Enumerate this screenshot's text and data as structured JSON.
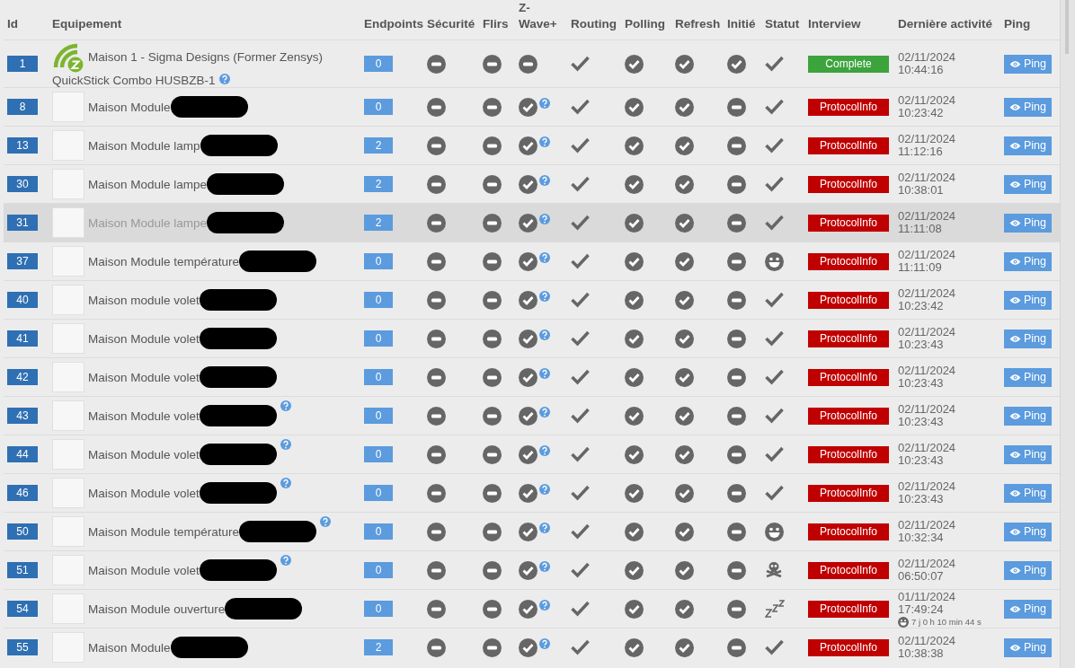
{
  "columns": [
    "Id",
    "Equipement",
    "Endpoints",
    "Sécurité",
    "Flirs",
    "Z-Wave+",
    "Routing",
    "Polling",
    "Refresh",
    "Initié",
    "Statut",
    "Interview",
    "Dernière activité",
    "Ping"
  ],
  "rows": [
    {
      "id": "1",
      "image": {
        "kind": "logo"
      },
      "name": "Maison 1 - Sigma Designs (Former Zensys)",
      "name_continued": "QuickStick Combo HUSBZB-1",
      "redacted": false,
      "name_help": true,
      "highlighted": false,
      "endpoints": "0",
      "indicators": [
        {
          "kind": "minus",
          "help": false
        },
        {
          "kind": "minus",
          "help": false
        },
        {
          "kind": "minus",
          "help": false
        },
        {
          "kind": "check",
          "help": false
        },
        {
          "kind": "check-circle",
          "help": false
        },
        {
          "kind": "check-circle",
          "help": false
        },
        {
          "kind": "check-circle",
          "help": false
        },
        {
          "kind": "check",
          "help": false
        }
      ],
      "interview": {
        "label": "Complete",
        "kind": "complete"
      },
      "date": "02/11/2024",
      "time": "10:44:16",
      "ping": "Ping"
    },
    {
      "id": "8",
      "image": {
        "kind": "photo"
      },
      "name": "Maison Module",
      "redacted": true,
      "name_help": false,
      "highlighted": false,
      "endpoints": "0",
      "indicators": [
        {
          "kind": "minus",
          "help": false
        },
        {
          "kind": "minus",
          "help": false
        },
        {
          "kind": "check-circle",
          "help": true
        },
        {
          "kind": "check",
          "help": false
        },
        {
          "kind": "check-circle",
          "help": false
        },
        {
          "kind": "check-circle",
          "help": false
        },
        {
          "kind": "minus",
          "help": false
        },
        {
          "kind": "check",
          "help": false
        }
      ],
      "interview": {
        "label": "ProtocolInfo",
        "kind": "error"
      },
      "date": "02/11/2024",
      "time": "10:23:42",
      "ping": "Ping"
    },
    {
      "id": "13",
      "image": {
        "kind": "photo"
      },
      "name": "Maison Module lamp",
      "redacted": true,
      "name_help": false,
      "highlighted": false,
      "endpoints": "2",
      "indicators": [
        {
          "kind": "minus",
          "help": false
        },
        {
          "kind": "minus",
          "help": false
        },
        {
          "kind": "check-circle",
          "help": true
        },
        {
          "kind": "check",
          "help": false
        },
        {
          "kind": "check-circle",
          "help": false
        },
        {
          "kind": "check-circle",
          "help": false
        },
        {
          "kind": "minus",
          "help": false
        },
        {
          "kind": "check",
          "help": false
        }
      ],
      "interview": {
        "label": "ProtocolInfo",
        "kind": "error"
      },
      "date": "02/11/2024",
      "time": "11:12:16",
      "ping": "Ping"
    },
    {
      "id": "30",
      "image": {
        "kind": "photo"
      },
      "name": "Maison Module lampe",
      "redacted": true,
      "name_help": false,
      "highlighted": false,
      "endpoints": "2",
      "indicators": [
        {
          "kind": "minus",
          "help": false
        },
        {
          "kind": "minus",
          "help": false
        },
        {
          "kind": "check-circle",
          "help": true
        },
        {
          "kind": "check",
          "help": false
        },
        {
          "kind": "check-circle",
          "help": false
        },
        {
          "kind": "check-circle",
          "help": false
        },
        {
          "kind": "minus",
          "help": false
        },
        {
          "kind": "check",
          "help": false
        }
      ],
      "interview": {
        "label": "ProtocolInfo",
        "kind": "error"
      },
      "date": "02/11/2024",
      "time": "10:38:01",
      "ping": "Ping"
    },
    {
      "id": "31",
      "image": {
        "kind": "photo"
      },
      "name": "Maison Module lampe",
      "redacted": true,
      "name_help": false,
      "highlighted": true,
      "endpoints": "2",
      "indicators": [
        {
          "kind": "minus",
          "help": false
        },
        {
          "kind": "minus",
          "help": false
        },
        {
          "kind": "check-circle",
          "help": true
        },
        {
          "kind": "check",
          "help": false
        },
        {
          "kind": "check-circle",
          "help": false
        },
        {
          "kind": "check-circle",
          "help": false
        },
        {
          "kind": "minus",
          "help": false
        },
        {
          "kind": "check",
          "help": false
        }
      ],
      "interview": {
        "label": "ProtocolInfo",
        "kind": "error"
      },
      "date": "02/11/2024",
      "time": "11:11:08",
      "ping": "Ping"
    },
    {
      "id": "37",
      "image": {
        "kind": "photo"
      },
      "name": "Maison Module température",
      "redacted": true,
      "name_help": false,
      "highlighted": false,
      "endpoints": "0",
      "indicators": [
        {
          "kind": "minus",
          "help": false
        },
        {
          "kind": "minus",
          "help": false
        },
        {
          "kind": "check-circle",
          "help": true
        },
        {
          "kind": "check",
          "help": false
        },
        {
          "kind": "check-circle",
          "help": false
        },
        {
          "kind": "check-circle",
          "help": false
        },
        {
          "kind": "minus",
          "help": false
        },
        {
          "kind": "smiley",
          "help": false
        }
      ],
      "interview": {
        "label": "ProtocolInfo",
        "kind": "error"
      },
      "date": "02/11/2024",
      "time": "11:11:09",
      "ping": "Ping"
    },
    {
      "id": "40",
      "image": {
        "kind": "photo"
      },
      "name": "Maison module volet",
      "redacted": true,
      "name_help": false,
      "highlighted": false,
      "endpoints": "0",
      "indicators": [
        {
          "kind": "minus",
          "help": false
        },
        {
          "kind": "minus",
          "help": false
        },
        {
          "kind": "check-circle",
          "help": true
        },
        {
          "kind": "check",
          "help": false
        },
        {
          "kind": "check-circle",
          "help": false
        },
        {
          "kind": "check-circle",
          "help": false
        },
        {
          "kind": "minus",
          "help": false
        },
        {
          "kind": "check",
          "help": false
        }
      ],
      "interview": {
        "label": "ProtocolInfo",
        "kind": "error"
      },
      "date": "02/11/2024",
      "time": "10:23:42",
      "ping": "Ping"
    },
    {
      "id": "41",
      "image": {
        "kind": "photo"
      },
      "name": "Maison Module volet",
      "redacted": true,
      "name_help": false,
      "highlighted": false,
      "endpoints": "0",
      "indicators": [
        {
          "kind": "minus",
          "help": false
        },
        {
          "kind": "minus",
          "help": false
        },
        {
          "kind": "check-circle",
          "help": true
        },
        {
          "kind": "check",
          "help": false
        },
        {
          "kind": "check-circle",
          "help": false
        },
        {
          "kind": "check-circle",
          "help": false
        },
        {
          "kind": "minus",
          "help": false
        },
        {
          "kind": "check",
          "help": false
        }
      ],
      "interview": {
        "label": "ProtocolInfo",
        "kind": "error"
      },
      "date": "02/11/2024",
      "time": "10:23:43",
      "ping": "Ping"
    },
    {
      "id": "42",
      "image": {
        "kind": "photo"
      },
      "name": "Maison Module volet",
      "redacted": true,
      "name_help": false,
      "highlighted": false,
      "endpoints": "0",
      "indicators": [
        {
          "kind": "minus",
          "help": false
        },
        {
          "kind": "minus",
          "help": false
        },
        {
          "kind": "check-circle",
          "help": true
        },
        {
          "kind": "check",
          "help": false
        },
        {
          "kind": "check-circle",
          "help": false
        },
        {
          "kind": "check-circle",
          "help": false
        },
        {
          "kind": "minus",
          "help": false
        },
        {
          "kind": "check",
          "help": false
        }
      ],
      "interview": {
        "label": "ProtocolInfo",
        "kind": "error"
      },
      "date": "02/11/2024",
      "time": "10:23:43",
      "ping": "Ping"
    },
    {
      "id": "43",
      "image": {
        "kind": "photo"
      },
      "name": "Maison Module volet",
      "redacted": true,
      "name_help": true,
      "highlighted": false,
      "endpoints": "0",
      "indicators": [
        {
          "kind": "minus",
          "help": false
        },
        {
          "kind": "minus",
          "help": false
        },
        {
          "kind": "check-circle",
          "help": true
        },
        {
          "kind": "check",
          "help": false
        },
        {
          "kind": "check-circle",
          "help": false
        },
        {
          "kind": "check-circle",
          "help": false
        },
        {
          "kind": "minus",
          "help": false
        },
        {
          "kind": "check",
          "help": false
        }
      ],
      "interview": {
        "label": "ProtocolInfo",
        "kind": "error"
      },
      "date": "02/11/2024",
      "time": "10:23:43",
      "ping": "Ping"
    },
    {
      "id": "44",
      "image": {
        "kind": "photo"
      },
      "name": "Maison Module volet",
      "redacted": true,
      "name_help": true,
      "highlighted": false,
      "endpoints": "0",
      "indicators": [
        {
          "kind": "minus",
          "help": false
        },
        {
          "kind": "minus",
          "help": false
        },
        {
          "kind": "check-circle",
          "help": true
        },
        {
          "kind": "check",
          "help": false
        },
        {
          "kind": "check-circle",
          "help": false
        },
        {
          "kind": "check-circle",
          "help": false
        },
        {
          "kind": "minus",
          "help": false
        },
        {
          "kind": "check",
          "help": false
        }
      ],
      "interview": {
        "label": "ProtocolInfo",
        "kind": "error"
      },
      "date": "02/11/2024",
      "time": "10:23:43",
      "ping": "Ping"
    },
    {
      "id": "46",
      "image": {
        "kind": "photo"
      },
      "name": "Maison Module volet",
      "redacted": true,
      "name_help": true,
      "highlighted": false,
      "endpoints": "0",
      "indicators": [
        {
          "kind": "minus",
          "help": false
        },
        {
          "kind": "minus",
          "help": false
        },
        {
          "kind": "check-circle",
          "help": true
        },
        {
          "kind": "check",
          "help": false
        },
        {
          "kind": "check-circle",
          "help": false
        },
        {
          "kind": "check-circle",
          "help": false
        },
        {
          "kind": "minus",
          "help": false
        },
        {
          "kind": "check",
          "help": false
        }
      ],
      "interview": {
        "label": "ProtocolInfo",
        "kind": "error"
      },
      "date": "02/11/2024",
      "time": "10:23:43",
      "ping": "Ping"
    },
    {
      "id": "50",
      "image": {
        "kind": "photo"
      },
      "name": "Maison Module température",
      "redacted": true,
      "name_help": true,
      "highlighted": false,
      "endpoints": "0",
      "indicators": [
        {
          "kind": "minus",
          "help": false
        },
        {
          "kind": "minus",
          "help": false
        },
        {
          "kind": "check-circle",
          "help": true
        },
        {
          "kind": "check",
          "help": false
        },
        {
          "kind": "check-circle",
          "help": false
        },
        {
          "kind": "check-circle",
          "help": false
        },
        {
          "kind": "minus",
          "help": false
        },
        {
          "kind": "smiley",
          "help": false
        }
      ],
      "interview": {
        "label": "ProtocolInfo",
        "kind": "error"
      },
      "date": "02/11/2024",
      "time": "10:32:34",
      "ping": "Ping"
    },
    {
      "id": "51",
      "image": {
        "kind": "photo"
      },
      "name": "Maison Module volet",
      "redacted": true,
      "name_help": true,
      "highlighted": false,
      "endpoints": "0",
      "indicators": [
        {
          "kind": "minus",
          "help": false
        },
        {
          "kind": "minus",
          "help": false
        },
        {
          "kind": "check-circle",
          "help": true
        },
        {
          "kind": "check",
          "help": false
        },
        {
          "kind": "check-circle",
          "help": false
        },
        {
          "kind": "check-circle",
          "help": false
        },
        {
          "kind": "minus",
          "help": false
        },
        {
          "kind": "skull",
          "help": false
        }
      ],
      "interview": {
        "label": "ProtocolInfo",
        "kind": "error"
      },
      "date": "02/11/2024",
      "time": "06:50:07",
      "ping": "Ping"
    },
    {
      "id": "54",
      "image": {
        "kind": "photo"
      },
      "name": "Maison Module ouverture",
      "redacted": true,
      "name_help": false,
      "highlighted": false,
      "endpoints": "0",
      "indicators": [
        {
          "kind": "minus",
          "help": false
        },
        {
          "kind": "minus",
          "help": false
        },
        {
          "kind": "check-circle",
          "help": true
        },
        {
          "kind": "check",
          "help": false
        },
        {
          "kind": "check-circle",
          "help": false
        },
        {
          "kind": "check-circle",
          "help": false
        },
        {
          "kind": "minus",
          "help": false
        },
        {
          "kind": "sleep",
          "help": false
        }
      ],
      "interview": {
        "label": "ProtocolInfo",
        "kind": "error"
      },
      "date": "01/11/2024",
      "time": "17:49:24",
      "uptime": "7 j 0 h 10 min 44 s",
      "ping": "Ping"
    },
    {
      "id": "55",
      "image": {
        "kind": "photo"
      },
      "name": "Maison Module",
      "redacted": true,
      "name_help": false,
      "highlighted": false,
      "endpoints": "2",
      "indicators": [
        {
          "kind": "minus",
          "help": false
        },
        {
          "kind": "minus",
          "help": false
        },
        {
          "kind": "check-circle",
          "help": true
        },
        {
          "kind": "check",
          "help": false
        },
        {
          "kind": "check-circle",
          "help": false
        },
        {
          "kind": "check-circle",
          "help": false
        },
        {
          "kind": "minus",
          "help": false
        },
        {
          "kind": "check",
          "help": false
        }
      ],
      "interview": {
        "label": "ProtocolInfo",
        "kind": "error"
      },
      "date": "02/11/2024",
      "time": "10:38:38",
      "ping": "Ping"
    }
  ]
}
